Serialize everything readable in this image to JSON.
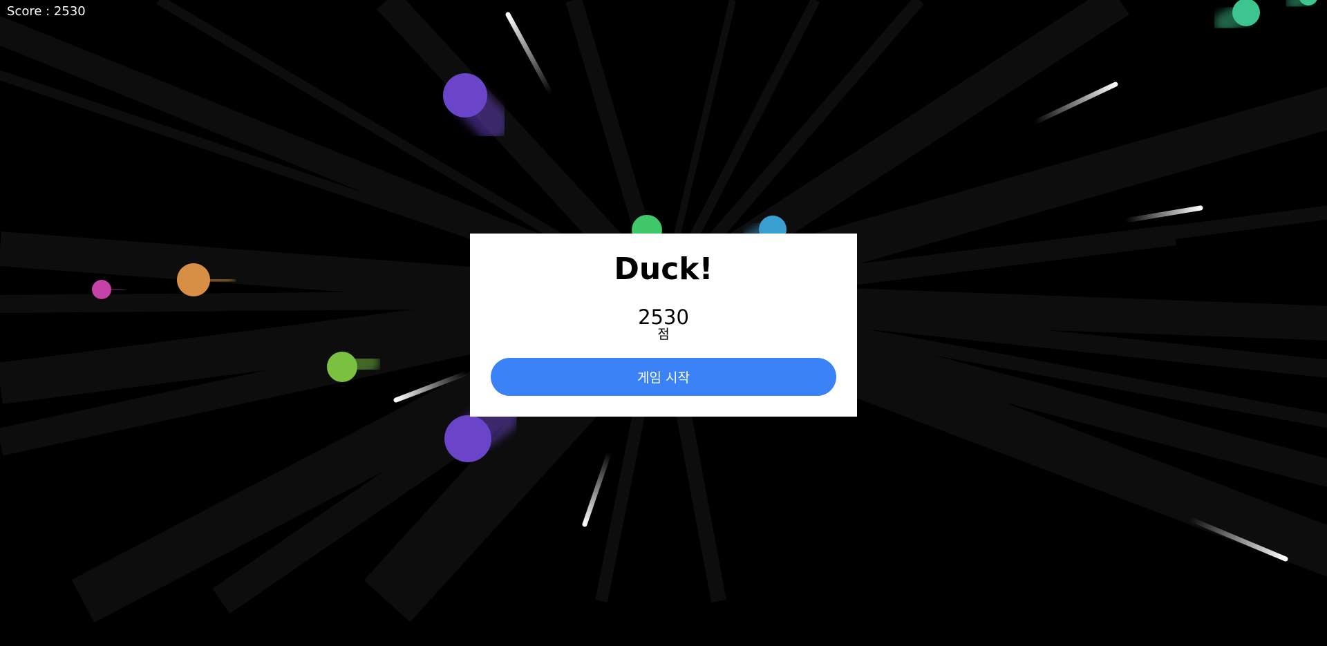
{
  "hud": {
    "score_text": "Score : 2530"
  },
  "modal": {
    "title": "Duck!",
    "score_value": "2530",
    "score_unit": "점",
    "start_button_label": "게임 시작"
  },
  "colors": {
    "background": "#000000",
    "modal_background": "#ffffff",
    "button": "#3b82f6",
    "button_text": "#ffffff",
    "orb_purple": "#6a45c9",
    "orb_orange": "#d68f45",
    "orb_pink": "#c441a6",
    "orb_lime": "#7ac142",
    "orb_green": "#3fc76a",
    "orb_teal": "#3ec48f",
    "orb_blue": "#3a9fd0",
    "streak_white": "#ffffff"
  }
}
